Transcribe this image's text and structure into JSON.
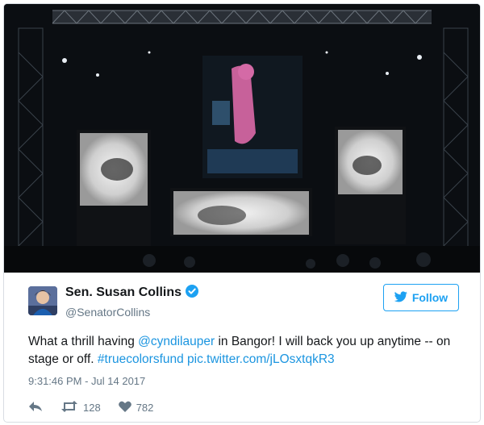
{
  "tweet": {
    "display_name": "Sen. Susan Collins",
    "handle": "@SenatorCollins",
    "follow_label": "Follow",
    "text_before": "What a thrill having ",
    "mention": "@cyndilauper",
    "text_middle": " in Bangor! I will back you up anytime -- on stage or off. ",
    "hashtag": "#truecolorsfund",
    "pic_link": "pic.twitter.com/jLOsxtqkR3",
    "timestamp": "9:31:46 PM - Jul 14 2017",
    "retweets": "128",
    "likes": "782"
  },
  "icons": {
    "verified": "verified-badge-icon",
    "follow": "twitter-bird-icon",
    "reply": "reply-icon",
    "retweet": "retweet-icon",
    "like": "heart-icon"
  },
  "colors": {
    "accent": "#1da1f2",
    "link": "#1b95e0",
    "text": "#14171a",
    "muted": "#657786"
  }
}
